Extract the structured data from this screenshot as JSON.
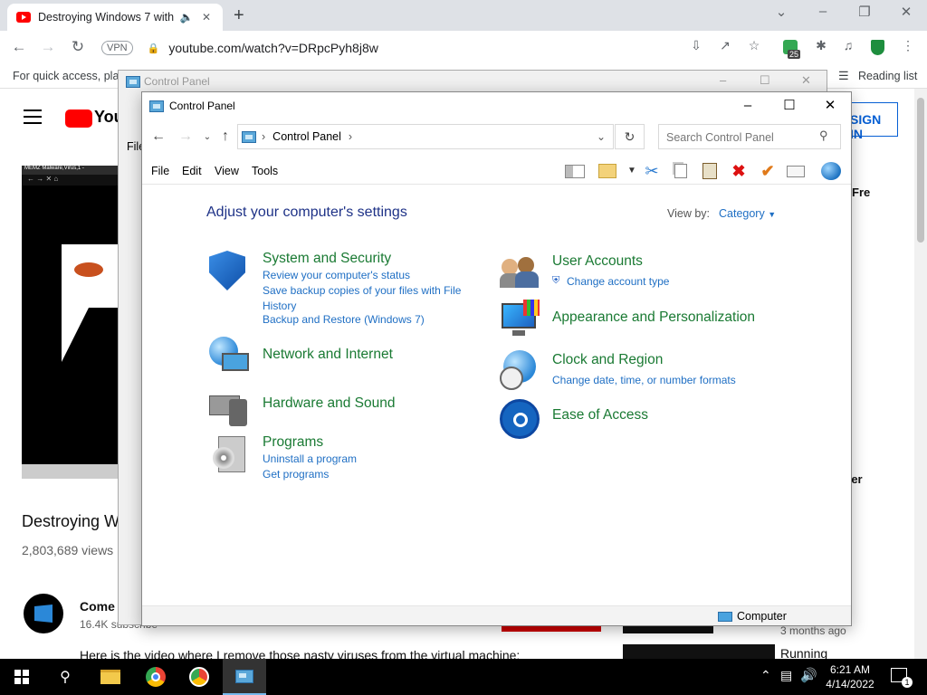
{
  "browser": {
    "tab_title": "Destroying Windows 7 with",
    "vpn_label": "VPN",
    "url": "youtube.com/watch?v=DRpcPyh8j8w",
    "bookmarks_hint": "For quick access, plac",
    "reading_list": "Reading list",
    "extension_badge": "25"
  },
  "youtube": {
    "video_title": "Destroying W",
    "views": "2,803,689 views",
    "channel_name": "Come on W",
    "subscribers": "16.4K subscribe",
    "description": "Here is the video where I remove those nasty viruses from the virtual machine:",
    "sign_in": "SIGN IN",
    "side_title_1": "rFre",
    "side_title_2": "ter",
    "side_meta": "3 months ago",
    "side_title_3": "Running",
    "video_menubar": "MEMZ Malware,Virus,1 -"
  },
  "back_window": {
    "title": "Control Panel",
    "menu_file": "File"
  },
  "control_panel": {
    "title": "Control Panel",
    "breadcrumb": "Control Panel",
    "search_placeholder": "Search Control Panel",
    "menu": [
      "File",
      "Edit",
      "View",
      "Tools"
    ],
    "heading": "Adjust your computer's settings",
    "view_by_label": "View by:",
    "view_by_value": "Category",
    "categories_left": [
      {
        "title": "System and Security",
        "links": [
          "Review your computer's status",
          "Save backup copies of your files with File History",
          "Backup and Restore (Windows 7)"
        ]
      },
      {
        "title": "Network and Internet",
        "links": []
      },
      {
        "title": "Hardware and Sound",
        "links": []
      },
      {
        "title": "Programs",
        "links": [
          "Uninstall a program",
          "Get programs"
        ]
      }
    ],
    "categories_right": [
      {
        "title": "User Accounts",
        "links": [
          "Change account type"
        ]
      },
      {
        "title": "Appearance and Personalization",
        "links": []
      },
      {
        "title": "Clock and Region",
        "links": [
          "Change date, time, or number formats"
        ]
      },
      {
        "title": "Ease of Access",
        "links": []
      }
    ],
    "status_item": "Computer"
  },
  "taskbar": {
    "time": "6:21 AM",
    "date": "4/14/2022",
    "notification_count": "1"
  },
  "colors": {
    "category_green": "#1a7a33",
    "link_blue": "#1f6fc4",
    "heading_blue": "#1e3287",
    "youtube_red": "#ff0000"
  }
}
